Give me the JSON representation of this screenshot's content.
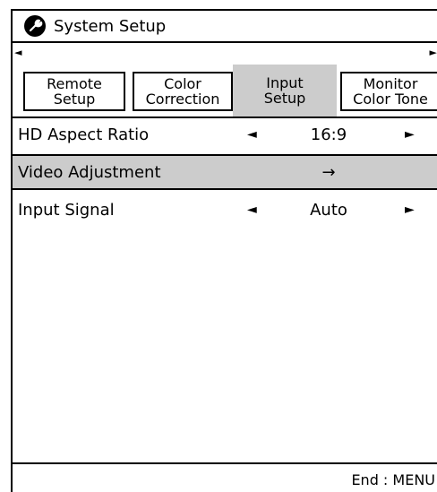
{
  "title": {
    "icon": "wrench-icon",
    "text": "System Setup"
  },
  "tabs": {
    "scroll_left": "◄",
    "scroll_right": "►",
    "items": [
      {
        "line1": "Remote",
        "line2": "Setup",
        "active": false
      },
      {
        "line1": "Color",
        "line2": "Correction",
        "active": false
      },
      {
        "line1": "Input",
        "line2": "Setup",
        "active": true
      },
      {
        "line1": "Monitor",
        "line2": "Color Tone",
        "active": false
      }
    ]
  },
  "menu": {
    "rows": [
      {
        "label": "HD Aspect Ratio",
        "left": "◄",
        "value": "16:9",
        "right": "►",
        "selected": false
      },
      {
        "label": "Video Adjustment",
        "left": "",
        "value": "→",
        "right": "",
        "selected": true
      },
      {
        "label": "Input Signal",
        "left": "◄",
        "value": "Auto",
        "right": "►",
        "selected": false
      }
    ]
  },
  "footer": {
    "text": "End : MENU"
  },
  "colors": {
    "highlight": "#cccccc",
    "border": "#000000",
    "background": "#ffffff"
  }
}
